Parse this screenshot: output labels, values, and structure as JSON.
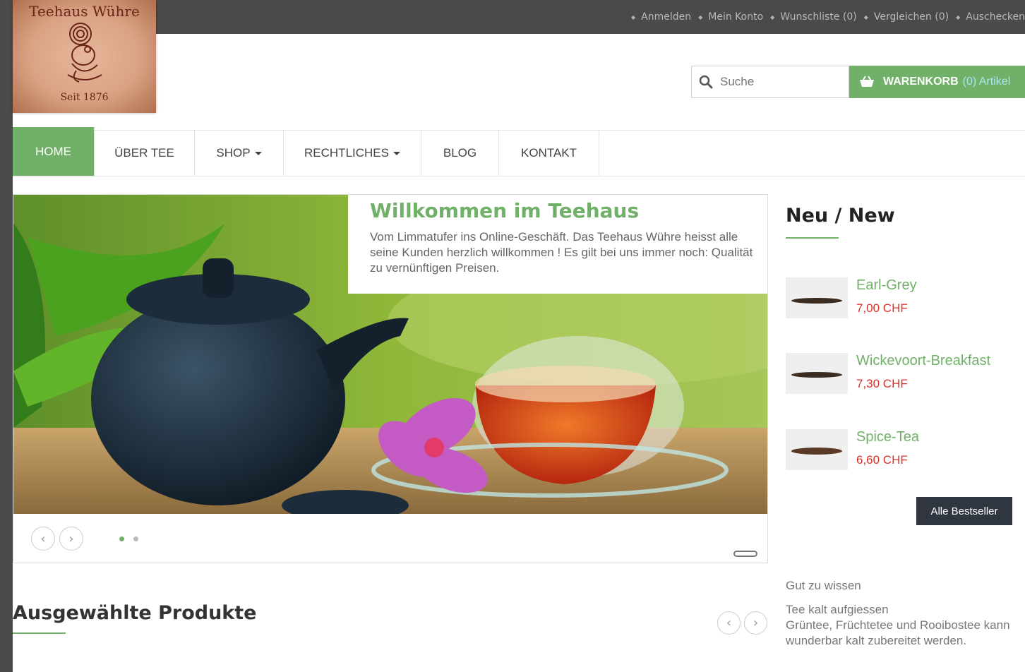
{
  "topbar": {
    "links": [
      "Anmelden",
      "Mein Konto",
      "Wunschliste (0)",
      "Vergleichen (0)",
      "Auschecken"
    ]
  },
  "logo": {
    "title": "Teehaus Wühre",
    "subtitle": "Seit 1876"
  },
  "search": {
    "placeholder": "Suche"
  },
  "cart": {
    "label": "WARENKORB",
    "count": "(0) Artikel"
  },
  "nav": {
    "items": [
      {
        "label": "HOME",
        "active": true
      },
      {
        "label": "ÜBER TEE"
      },
      {
        "label": "SHOP",
        "dropdown": true
      },
      {
        "label": "RECHTLICHES",
        "dropdown": true
      },
      {
        "label": "BLOG"
      },
      {
        "label": "KONTAKT"
      }
    ]
  },
  "slider": {
    "title": "Willkommen im Teehaus",
    "text": "Vom Limmatufer ins Online-Geschäft. Das Teehaus Wühre heisst alle seine Kunden herzlich willkommen ! Es gilt bei uns immer noch: Qualität zu vernünftigen Preisen."
  },
  "sidebar": {
    "title": "Neu / New",
    "products": [
      {
        "name": "Earl-Grey",
        "price": "7,00 CHF"
      },
      {
        "name": "Wickevoort-Breakfast",
        "price": "7,30 CHF"
      },
      {
        "name": "Spice-Tea",
        "price": "6,60 CHF"
      }
    ],
    "bestseller_button": "Alle Bestseller",
    "info_title": "Gut zu wissen",
    "info_subtitle": "Tee kalt aufgiessen",
    "info_text": "Grüntee, Früchtetee und Rooibostee kann wunderbar kalt zubereitet werden."
  },
  "featured": {
    "title": "Ausgewählte Produkte"
  },
  "colors": {
    "accent": "#71b068",
    "price": "#d9312a",
    "topbar": "#4a4a4a",
    "button_dark": "#2f3640"
  }
}
